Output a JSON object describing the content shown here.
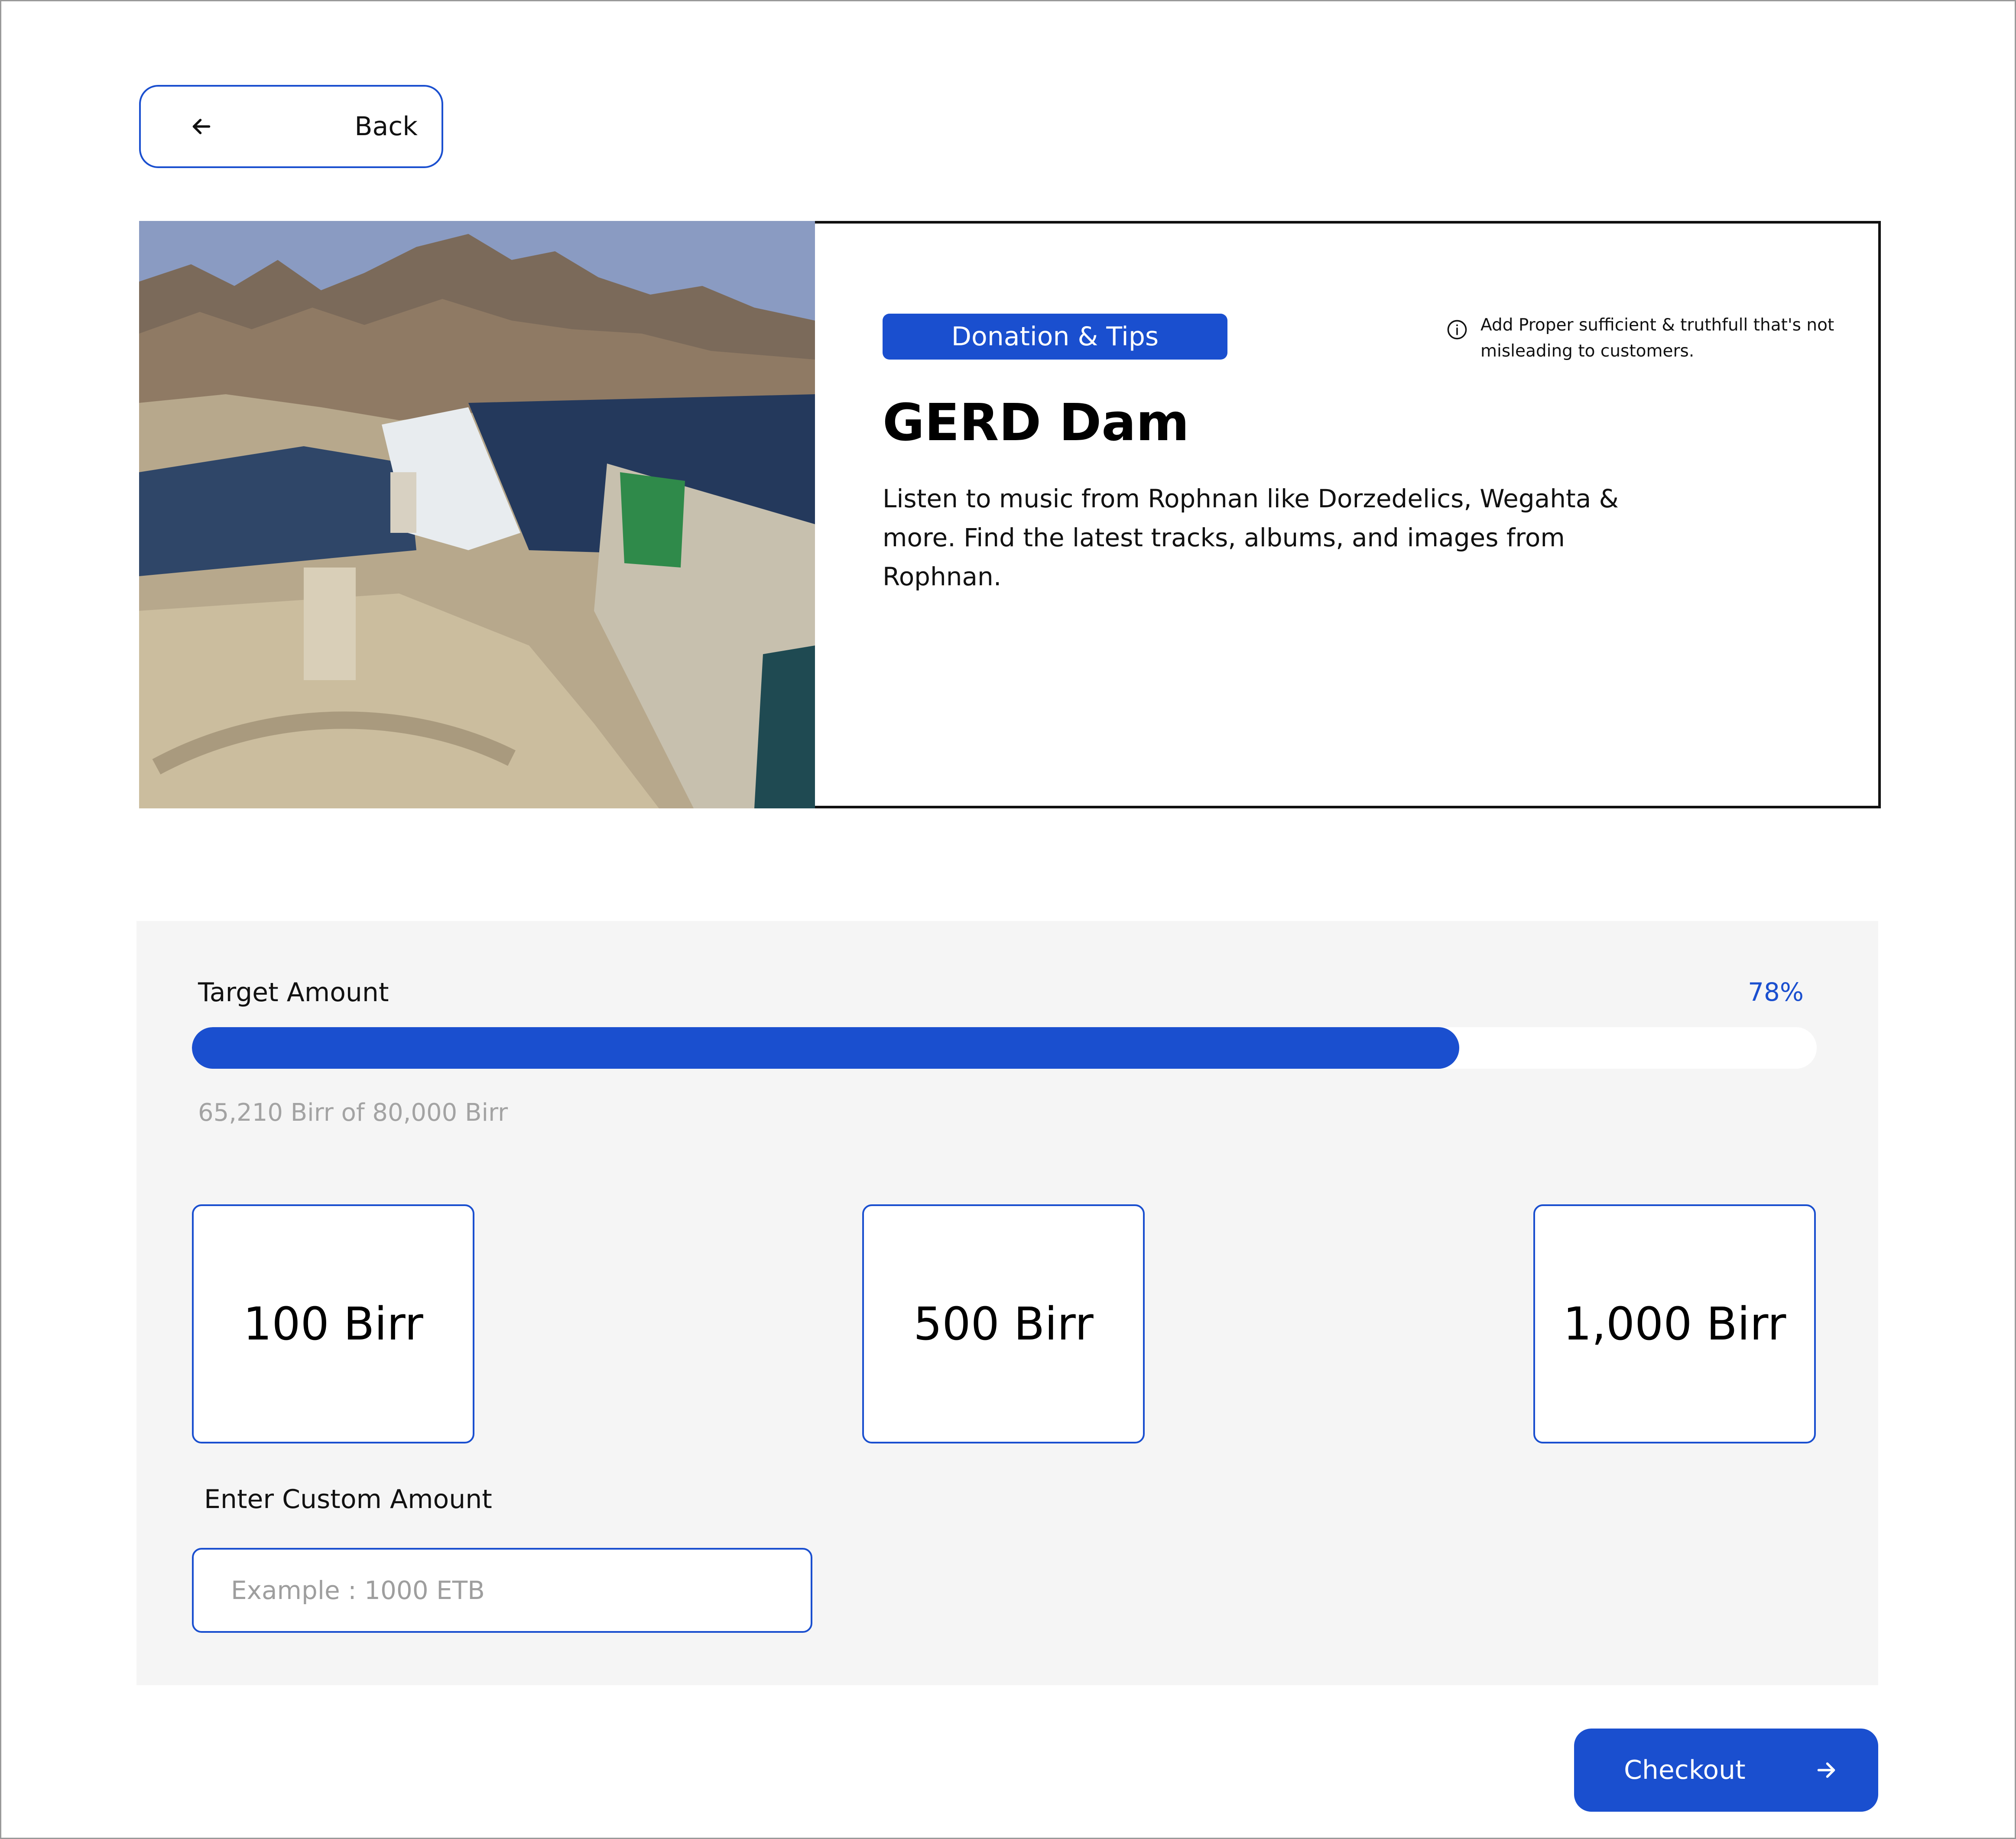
{
  "nav": {
    "back_label": "Back",
    "back_icon": "arrow-left-icon"
  },
  "campaign": {
    "category": "Donation & Tips",
    "info_icon": "info-icon",
    "info_note": "Add Proper sufficient & truthfull that's not misleading to customers.",
    "title": "GERD Dam",
    "description": "Listen to music from Rophnan like Dorzedelics, Wegahta & more. Find the latest tracks, albums, and images from Rophnan.",
    "image": "dam-photo"
  },
  "target": {
    "label": "Target Amount",
    "percent_label": "78%",
    "progress_fraction": 0.78,
    "caption": "65,210 Birr of 80,000 Birr"
  },
  "amounts": [
    {
      "label": "100 Birr"
    },
    {
      "label": "500 Birr"
    },
    {
      "label": "1,000 Birr"
    }
  ],
  "custom": {
    "label": "Enter Custom Amount",
    "placeholder": "Example : 1000 ETB",
    "value": ""
  },
  "checkout": {
    "label": "Checkout",
    "icon": "arrow-right-icon"
  },
  "colors": {
    "accent": "#1a4fcf",
    "panel_bg": "#f5f5f5",
    "muted_text": "#a3a3a3"
  }
}
